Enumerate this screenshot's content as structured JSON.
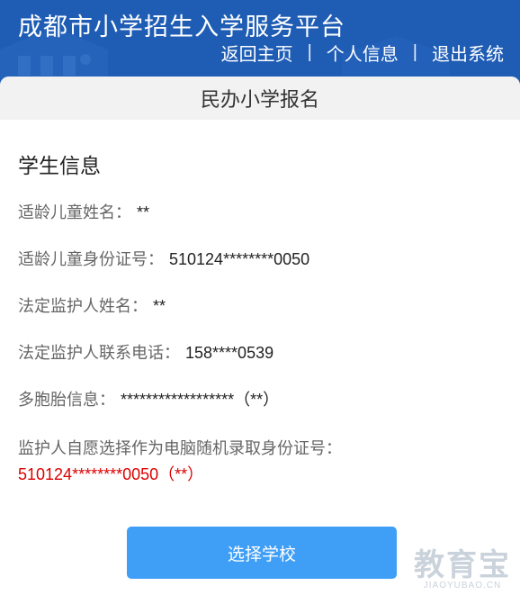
{
  "header": {
    "title": "成都市小学招生入学服务平台",
    "nav": [
      {
        "label": "返回主页"
      },
      {
        "label": "个人信息"
      },
      {
        "label": "退出系统"
      }
    ],
    "nav_separator": "|",
    "background_color": "#1f5db5"
  },
  "card": {
    "heading": "民办小学报名",
    "section_title": "学生信息",
    "fields": [
      {
        "label": "适龄儿童姓名：",
        "value": "**"
      },
      {
        "label": "适龄儿童身份证号：",
        "value": "510124********0050"
      },
      {
        "label": "法定监护人姓名：",
        "value": "**"
      },
      {
        "label": "法定监护人联系电话：",
        "value": "158****0539"
      },
      {
        "label": "多胞胎信息：",
        "value": "******************（**）"
      }
    ],
    "guardian_choice_label": "监护人自愿选择作为电脑随机录取身份证号：",
    "guardian_choice_value": "510124********0050（**）",
    "highlight_color": "#dd0000"
  },
  "actions": {
    "select_school_label": "选择学校",
    "button_color": "#3f9ef6"
  },
  "watermark": {
    "main": "教育宝",
    "sub": "JIAOYUBAO.CN"
  }
}
